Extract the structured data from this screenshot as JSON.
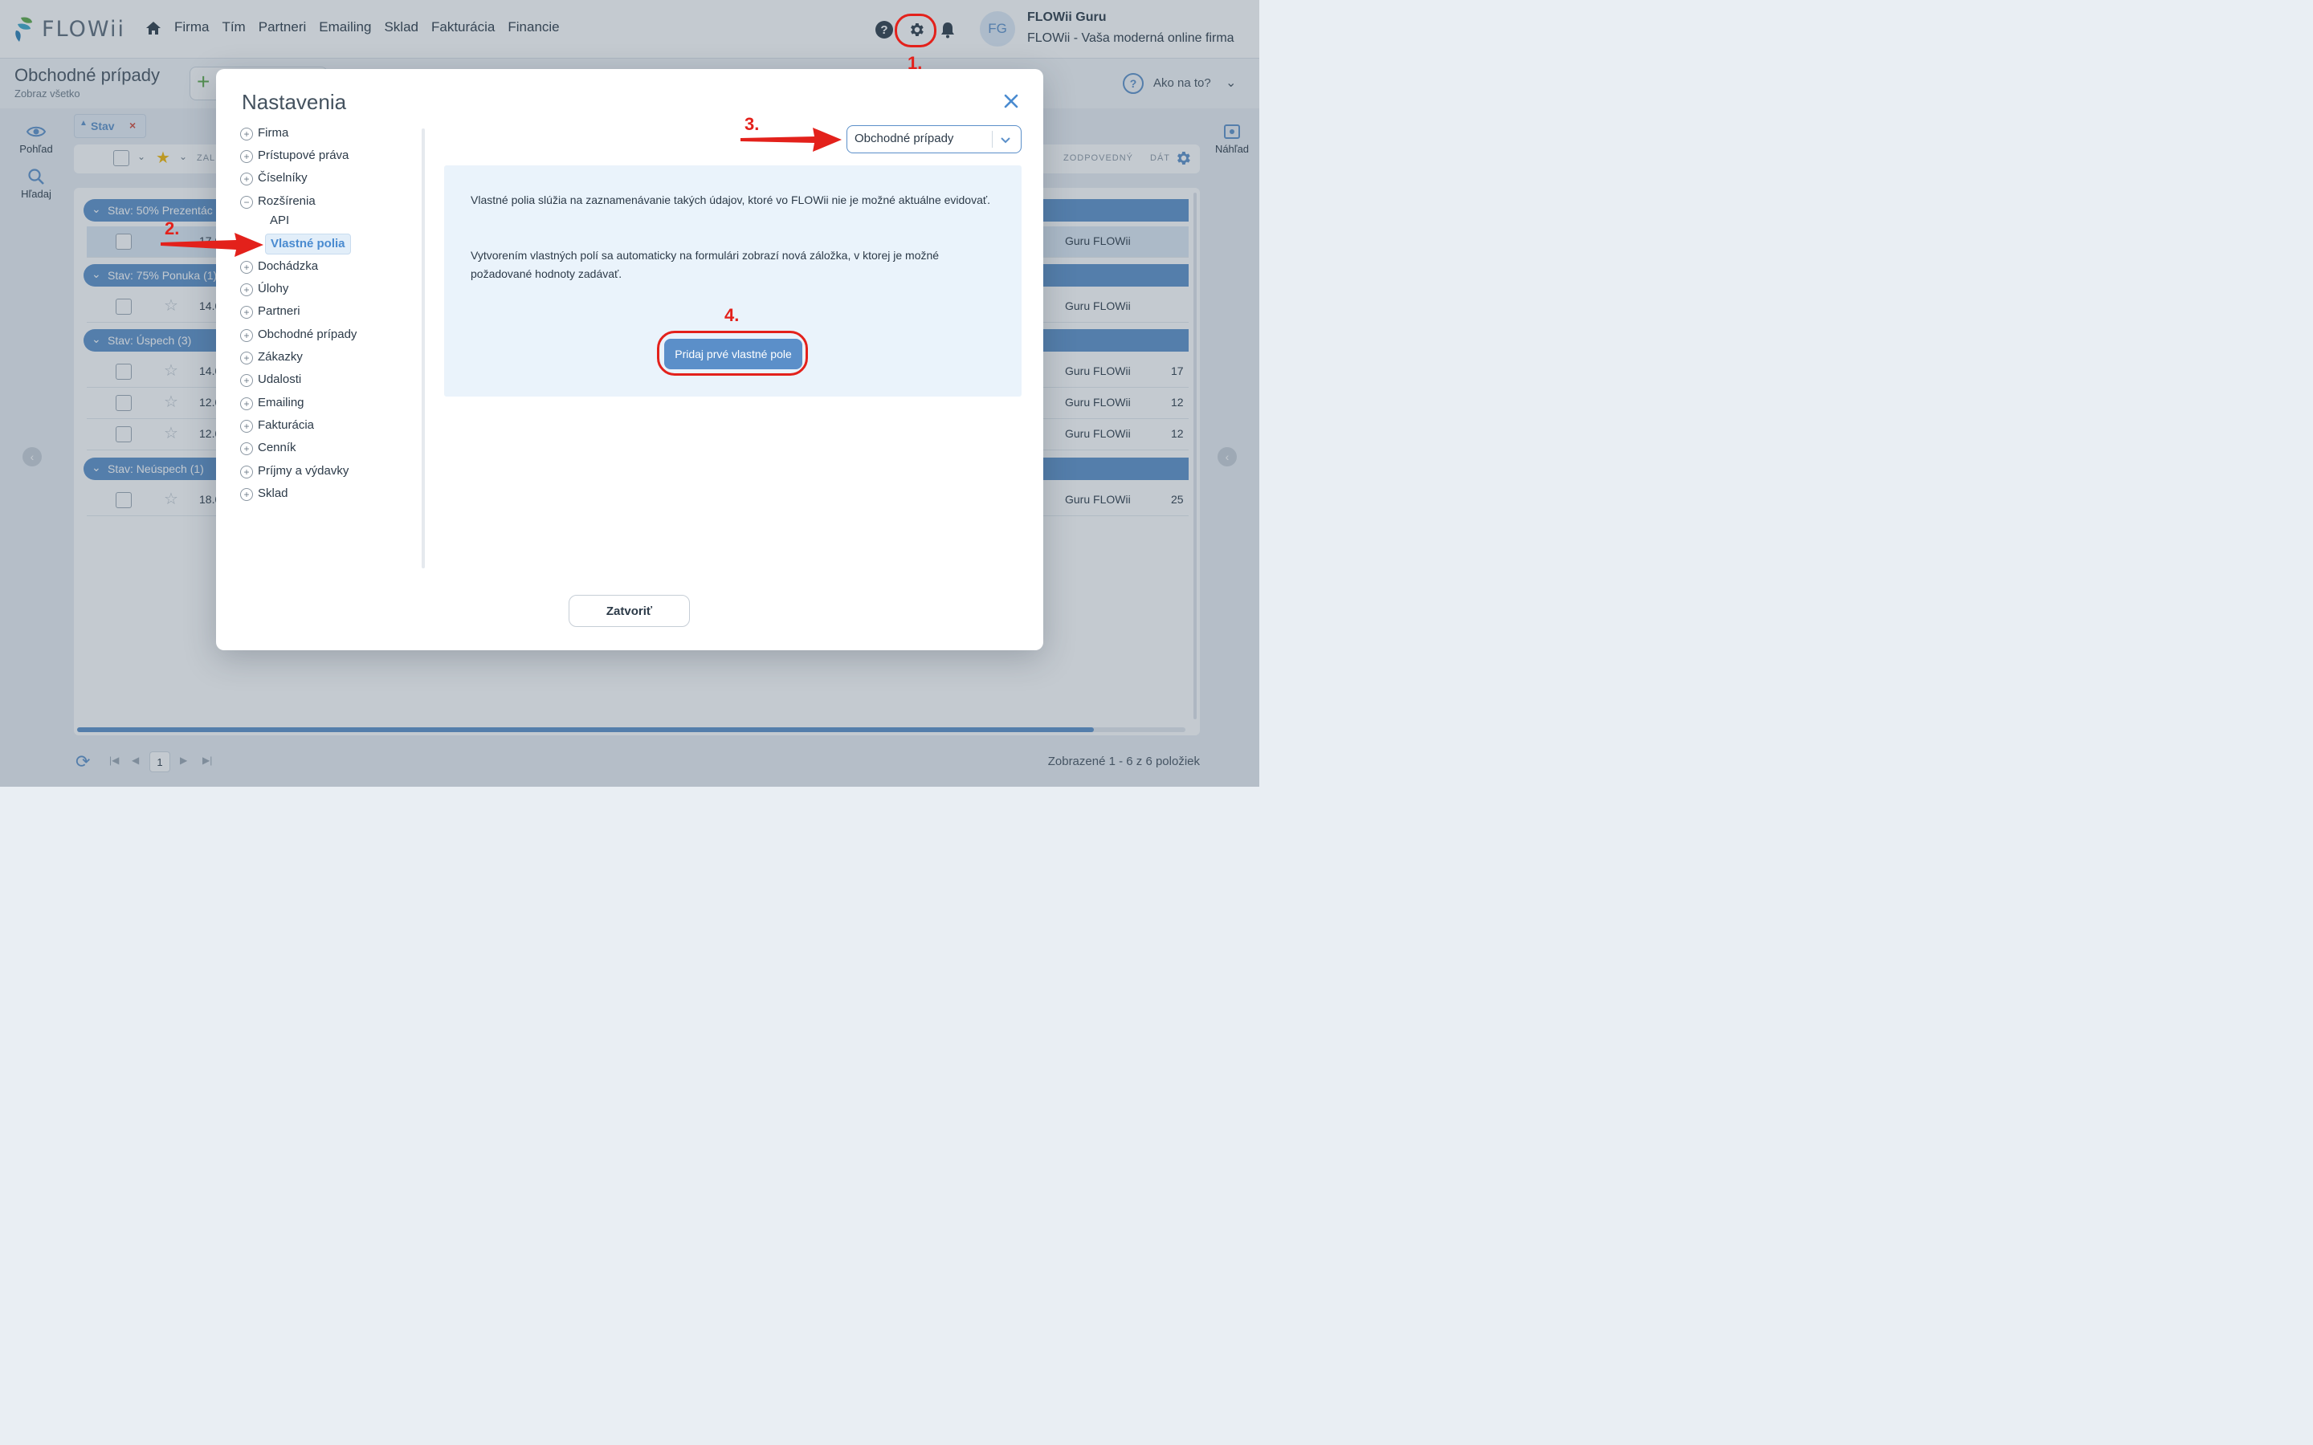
{
  "app": {
    "logo_text": "FLOWii",
    "nav": [
      "Firma",
      "Tím",
      "Partneri",
      "Emailing",
      "Sklad",
      "Fakturácia",
      "Financie"
    ],
    "user": {
      "initials": "FG",
      "name": "FLOWii Guru",
      "company": "FLOWii - Vaša moderná online firma"
    }
  },
  "page": {
    "title": "Obchodné prípady",
    "subtitle": "Zobraz všetko",
    "howto": "Ako na to?",
    "rail_left": [
      "Pohľad",
      "Hľadaj"
    ],
    "rail_right": [
      "Náhľad"
    ],
    "filter_chip": "Stav",
    "columns": [
      "ZAL",
      "ZODPOVEDNÝ",
      "DÁT"
    ],
    "groups": [
      "Stav: 50% Prezentác",
      "Stav: 75% Ponuka (1)",
      "Stav: Úspech (3)",
      "Stav: Neúspech (1)"
    ],
    "rows": [
      {
        "date": "17.0",
        "owner": "Guru FLOWii",
        "num": ""
      },
      {
        "date": "14.0",
        "owner": "Guru FLOWii",
        "num": ""
      },
      {
        "date": "14.0",
        "owner": "Guru FLOWii",
        "num": "17"
      },
      {
        "date": "12.0",
        "owner": "Guru FLOWii",
        "num": "12"
      },
      {
        "date": "12.0",
        "owner": "Guru FLOWii",
        "num": "12"
      },
      {
        "date": "18.0",
        "owner": "Guru FLOWii",
        "num": "25"
      }
    ],
    "current_page": "1",
    "footer_count": "Zobrazené 1 - 6 z 6 položiek"
  },
  "modal": {
    "title": "Nastavenia",
    "tree": [
      {
        "label": "Firma",
        "state": "+"
      },
      {
        "label": "Prístupové práva",
        "state": "+"
      },
      {
        "label": "Číselníky",
        "state": "+"
      },
      {
        "label": "Rozšírenia",
        "state": "−"
      },
      {
        "label": "Dochádzka",
        "state": "+"
      },
      {
        "label": "Úlohy",
        "state": "+"
      },
      {
        "label": "Partneri",
        "state": "+"
      },
      {
        "label": "Obchodné prípady",
        "state": "+"
      },
      {
        "label": "Zákazky",
        "state": "+"
      },
      {
        "label": "Udalosti",
        "state": "+"
      },
      {
        "label": "Emailing",
        "state": "+"
      },
      {
        "label": "Fakturácia",
        "state": "+"
      },
      {
        "label": "Cenník",
        "state": "+"
      },
      {
        "label": "Príjmy a výdavky",
        "state": "+"
      },
      {
        "label": "Sklad",
        "state": "+"
      }
    ],
    "tree_children": [
      "API",
      "Vlastné polia"
    ],
    "select_value": "Obchodné prípady",
    "info_1": "Vlastné polia slúžia na zaznamenávanie takých údajov, ktoré vo FLOWii nie je možné aktuálne evidovať.",
    "info_2": "Vytvorením vlastných polí sa automaticky na formulári zobrazí nová záložka, v ktorej je možné požadované hodnoty zadávať.",
    "primary_button": "Pridaj prvé vlastné pole",
    "close_button": "Zatvoriť"
  },
  "annotations": {
    "step1": "1.",
    "step2": "2.",
    "step3": "3.",
    "step4": "4.",
    "color": "#e3211b"
  },
  "colors": {
    "accent": "#5b8fc9",
    "active_link": "#4a8bd0",
    "brand_green": "#5aa846"
  }
}
